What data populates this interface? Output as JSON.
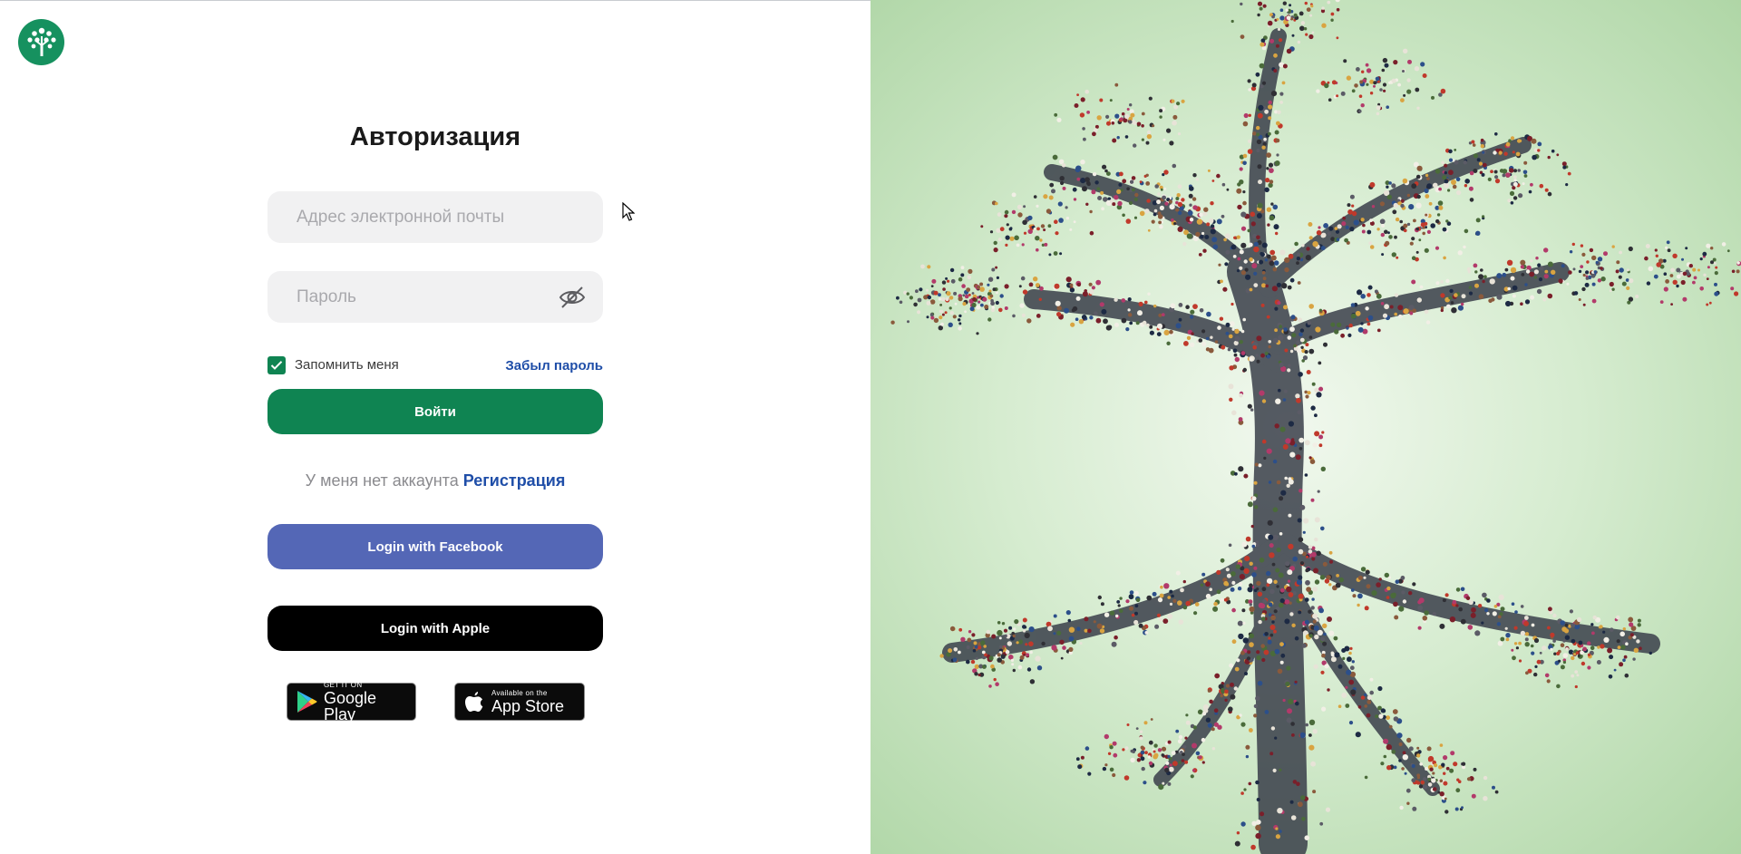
{
  "login": {
    "title": "Авторизация",
    "email_placeholder": "Адрес электронной почты",
    "password_placeholder": "Пароль",
    "remember_label": "Запомнить меня",
    "remember_checked": true,
    "forgot_label": "Забыл пароль",
    "submit_label": "Войти",
    "no_account_text": "У меня нет аккаунта",
    "register_label": "Регистрация",
    "facebook_label": "Login with Facebook",
    "apple_label": "Login with Apple"
  },
  "stores": {
    "google_small": "GET IT ON",
    "google_big": "Google Play",
    "apple_small": "Available on the",
    "apple_big": "App Store"
  },
  "colors": {
    "brand_green": "#0f8452",
    "logo_green": "#16915f",
    "link_blue": "#1f4ea8",
    "facebook_blue": "#5467b6",
    "apple_black": "#000000",
    "field_bg": "#f1f1f2"
  },
  "icons": {
    "logo": "tree-logo-icon",
    "password_toggle": "eye-off-icon",
    "checkbox": "check-icon",
    "google_play": "google-play-icon",
    "apple": "apple-icon",
    "cursor": "mouse-cursor-icon"
  }
}
